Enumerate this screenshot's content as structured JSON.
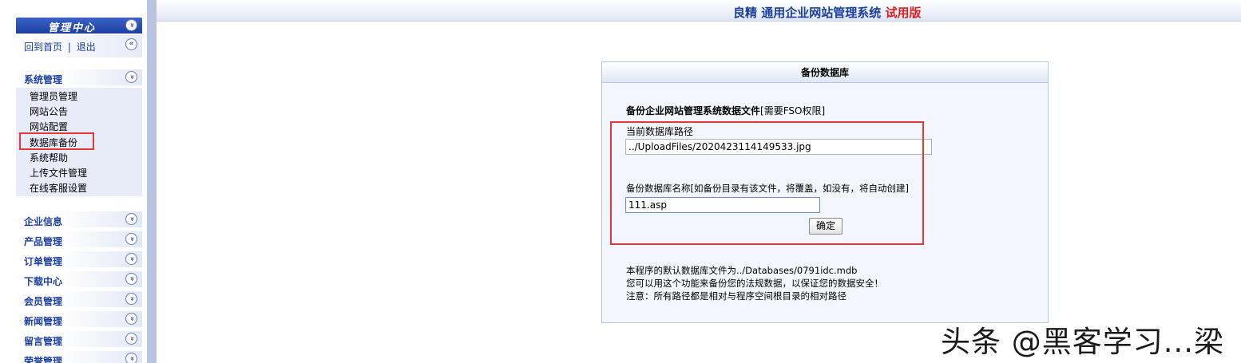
{
  "sidebar": {
    "header_title": "管理中心",
    "home_link": "回到首页",
    "separator": "|",
    "logout_link": "退出",
    "system_group": {
      "label": "系统管理",
      "items": [
        "管理员管理",
        "网站公告",
        "网站配置",
        "数据库备份",
        "系统帮助",
        "上传文件管理",
        "在线客服设置"
      ]
    },
    "groups": [
      "企业信息",
      "产品管理",
      "订单管理",
      "下载中心",
      "会员管理",
      "新闻管理",
      "留言管理",
      "荣誉管理"
    ],
    "toggle_glyph": "»",
    "collapse_glyph": "«"
  },
  "banner": {
    "brand": "良精 通用企业网站管理系统",
    "edition": "试用版"
  },
  "panel": {
    "title": "备份数据库",
    "heading": "备份企业网站管理系统数据文件",
    "heading_note": "[需要FSO权限]",
    "current_path_label": "当前数据库路径",
    "current_path_value": "../UploadFiles/2020423114149533.jpg",
    "backup_name_label": "备份数据库名称[如备份目录有该文件，将覆盖，如没有，将自动创建]",
    "backup_name_value": "111.asp",
    "confirm_button": "确定",
    "notes": [
      "本程序的默认数据库文件为../Databases/0791idc.mdb",
      "您可以用这个功能来备份您的法规数据，以保证您的数据安全！",
      "注意：所有路径都是相对与程序空间根目录的相对路径"
    ]
  },
  "watermark": "头条 @黑客学习...梁",
  "colors": {
    "accent": "#1a3fa0",
    "highlight": "#e53935",
    "trial": "#e02020"
  }
}
